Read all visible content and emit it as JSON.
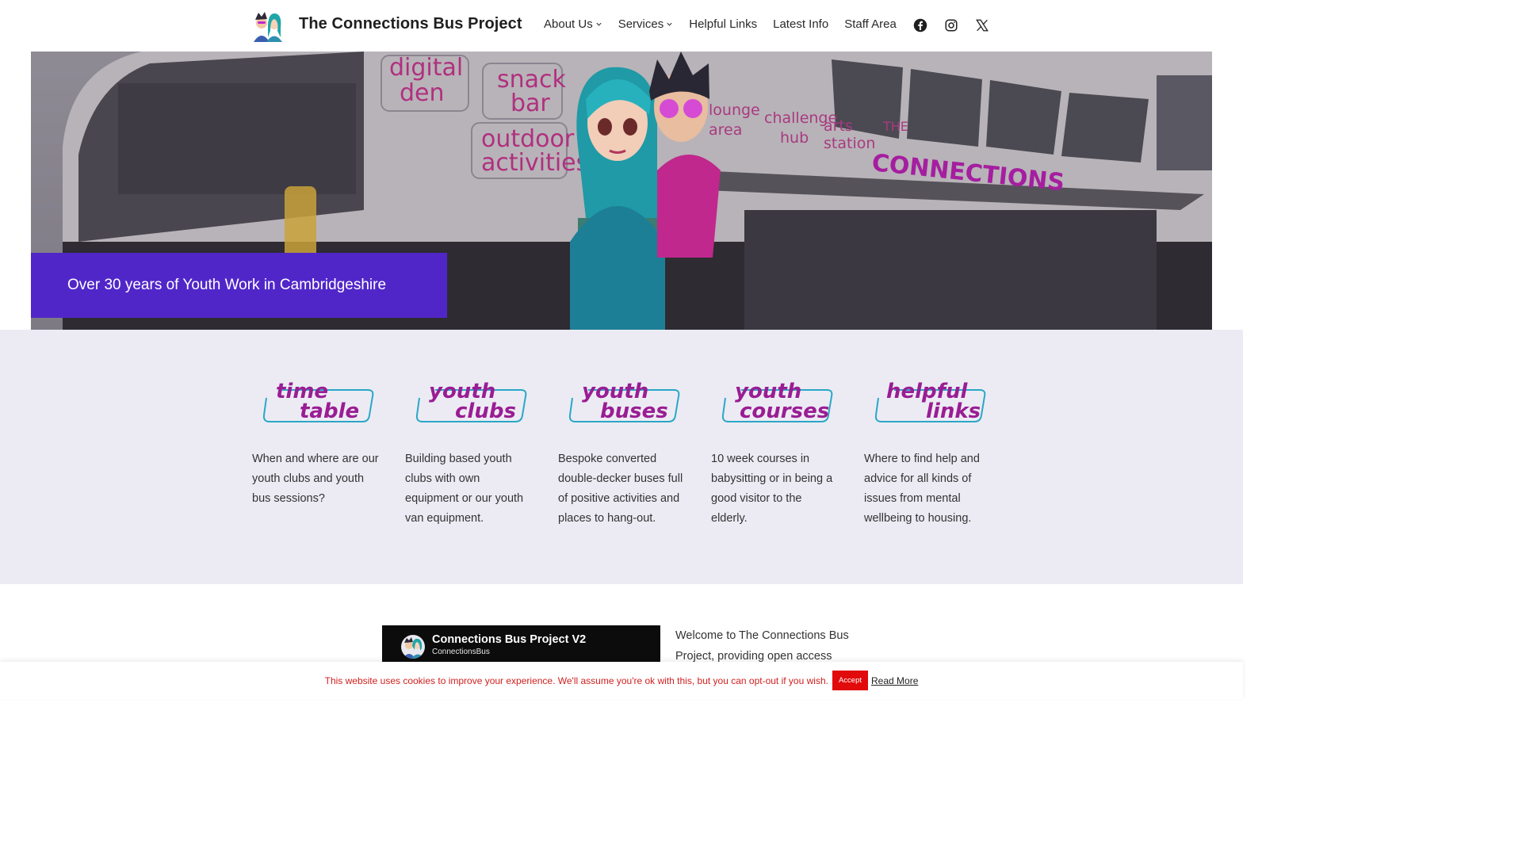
{
  "header": {
    "site_title": "The Connections Bus Project",
    "nav": [
      {
        "label": "About Us",
        "has_dropdown": true
      },
      {
        "label": "Services",
        "has_dropdown": true
      },
      {
        "label": "Helpful Links",
        "has_dropdown": false
      },
      {
        "label": "Latest Info",
        "has_dropdown": false
      },
      {
        "label": "Staff Area",
        "has_dropdown": false
      }
    ],
    "social_icons": [
      "facebook-icon",
      "instagram-icon",
      "x-twitter-icon"
    ]
  },
  "hero": {
    "caption": "Over 30 years of Youth Work in Cambridgeshire",
    "bus_signs": [
      "digital",
      "den",
      "snack",
      "bar",
      "outdoor",
      "activities",
      "lounge",
      "area",
      "challenge",
      "hub",
      "arts",
      "station",
      "THE",
      "CONNECTIONS"
    ]
  },
  "services": [
    {
      "logo_top": "time",
      "logo_bottom": "table",
      "description": "When and where are our youth clubs and youth bus sessions?"
    },
    {
      "logo_top": "youth",
      "logo_bottom": "clubs",
      "description": "Building based youth clubs with own equipment or our youth van equipment."
    },
    {
      "logo_top": "youth",
      "logo_bottom": "buses",
      "description": "Bespoke converted double-decker buses full of positive activities and places to hang-out."
    },
    {
      "logo_top": "youth",
      "logo_bottom": "courses",
      "description": "10 week courses in babysitting or in being a good visitor to the elderly."
    },
    {
      "logo_top": "helpful",
      "logo_bottom": "links",
      "description": "Where to find help and advice for all kinds of issues from mental wellbeing to housing."
    }
  ],
  "video": {
    "title": "Connections Bus Project V2",
    "channel": "ConnectionsBus"
  },
  "welcome": {
    "text": "Welcome to The Connections Bus Project, providing open access"
  },
  "cookie": {
    "message": "This website uses cookies to improve your experience. We'll assume you're ok with this, but you can opt-out if you wish.",
    "accept_label": "Accept",
    "read_more_label": "Read More"
  },
  "colors": {
    "brand_purple": "#5126c9",
    "logo_magenta": "#9a1d93",
    "logo_teal": "#2aa7c6",
    "band_bg": "#ecebf4",
    "cookie_red": "#e10b0b"
  }
}
